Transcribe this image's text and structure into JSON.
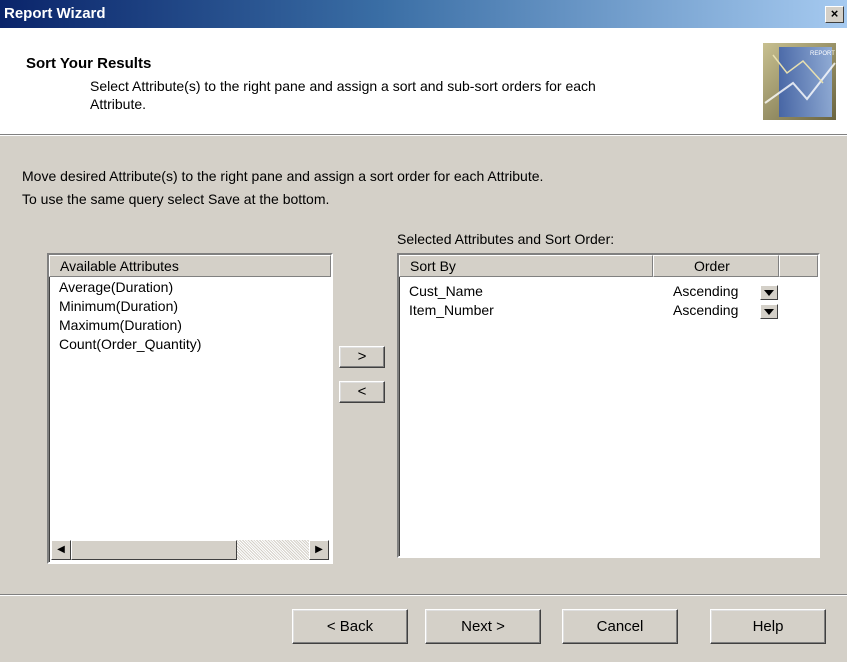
{
  "window": {
    "title": "Report Wizard",
    "close_label": "×"
  },
  "header": {
    "title": "Sort Your Results",
    "description_line1": "Select Attribute(s) to the right pane and assign a sort and sub-sort orders for each",
    "description_line2": "Attribute.",
    "image_caption": "REPORT"
  },
  "instructions": {
    "line1": "Move desired Attribute(s) to the right pane and assign a sort order for each Attribute.",
    "line2": "To use the same query select Save at the bottom."
  },
  "available": {
    "header": "Available Attributes",
    "items": [
      "Average(Duration)",
      "Minimum(Duration)",
      "Maximum(Duration)",
      "Count(Order_Quantity)"
    ]
  },
  "selected": {
    "label": "Selected Attributes and Sort Order:",
    "col_sortby": "Sort By",
    "col_order": "Order",
    "rows": [
      {
        "attr": "Cust_Name",
        "order": "Ascending"
      },
      {
        "attr": "Item_Number",
        "order": "Ascending"
      }
    ]
  },
  "move_buttons": {
    "add": ">",
    "remove": "<"
  },
  "footer": {
    "back": "< Back",
    "next": "Next >",
    "cancel": "Cancel",
    "help": "Help"
  }
}
